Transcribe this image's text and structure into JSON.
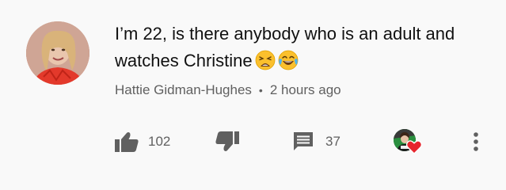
{
  "comment": {
    "text": "I’m 22, is there anybody who is an adult and watches Christine",
    "emojis": [
      "weary-face",
      "face-with-tears-of-joy"
    ],
    "author": "Hattie Gidman-Hughes",
    "separator": "•",
    "time": "2 hours ago",
    "likes": "102",
    "replies": "37"
  },
  "colors": {
    "background": "#f9f9f9",
    "meta_text": "#606060",
    "icon": "#606060",
    "heart": "#e6252d"
  }
}
